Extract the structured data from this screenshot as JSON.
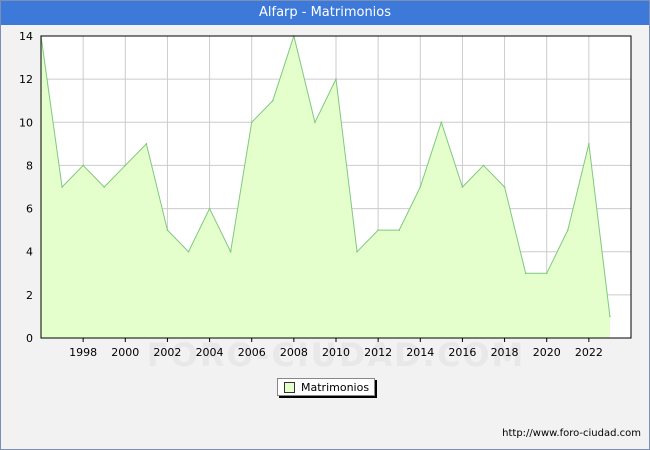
{
  "header": {
    "title": "Alfarp - Matrimonios"
  },
  "watermark": "FORO-CIUDAD.COM",
  "footer": {
    "credit": "http://www.foro-ciudad.com"
  },
  "colors": {
    "title_bg": "#3c79d8",
    "area_fill": "#e5ffcc",
    "line": "#80c880",
    "plot_bg": "#ffffff",
    "grid": "#cccccc"
  },
  "chart_data": {
    "type": "area",
    "title": "Alfarp - Matrimonios",
    "xlabel": "",
    "ylabel": "",
    "x": [
      1996,
      1997,
      1998,
      1999,
      2000,
      2001,
      2002,
      2003,
      2004,
      2005,
      2006,
      2007,
      2008,
      2009,
      2010,
      2011,
      2012,
      2013,
      2014,
      2015,
      2016,
      2017,
      2018,
      2019,
      2020,
      2021,
      2022,
      2023
    ],
    "series": [
      {
        "name": "Matrimonios",
        "values": [
          14,
          7,
          8,
          7,
          8,
          9,
          5,
          4,
          6,
          4,
          10,
          11,
          14,
          10,
          12,
          4,
          5,
          5,
          7,
          10,
          7,
          8,
          7,
          3,
          3,
          5,
          9,
          1
        ]
      }
    ],
    "xlim": [
      1996,
      2024
    ],
    "ylim": [
      0,
      14
    ],
    "x_ticks": [
      "1998",
      "2000",
      "2002",
      "2004",
      "2006",
      "2008",
      "2010",
      "2012",
      "2014",
      "2016",
      "2018",
      "2020",
      "2022"
    ],
    "y_ticks": [
      "0",
      "2",
      "4",
      "6",
      "8",
      "10",
      "12",
      "14"
    ],
    "grid": true,
    "legend": {
      "position": "bottom-center",
      "entries": [
        "Matrimonios"
      ]
    }
  }
}
